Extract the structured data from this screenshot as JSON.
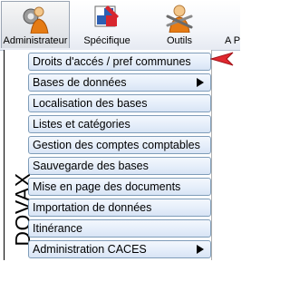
{
  "ribbon": {
    "tabs": [
      {
        "label": "Administrateur",
        "icon": "admin-gear-person-icon"
      },
      {
        "label": "Spécifique",
        "icon": "specific-tools-icon"
      },
      {
        "label": "Outils",
        "icon": "tools-person-icon"
      },
      {
        "label": "A P",
        "icon": ""
      }
    ],
    "active_tab": "Administrateur"
  },
  "panel": {
    "vertical_label": "DOVAX",
    "items": [
      {
        "label": "Droits d'accés / pref communes",
        "has_submenu": false
      },
      {
        "label": "Bases de données",
        "has_submenu": true
      },
      {
        "label": "Localisation des bases",
        "has_submenu": false
      },
      {
        "label": "Listes et catégories",
        "has_submenu": false
      },
      {
        "label": "Gestion des comptes comptables",
        "has_submenu": false
      },
      {
        "label": "Sauvegarde des bases",
        "has_submenu": false
      },
      {
        "label": "Mise en page des documents",
        "has_submenu": false
      },
      {
        "label": "Importation de données",
        "has_submenu": false
      },
      {
        "label": "Itinérance",
        "has_submenu": false
      },
      {
        "label": "Administration CACES",
        "has_submenu": true
      }
    ]
  },
  "colors": {
    "item_border": "#7f9db9",
    "pointer_arrow": "#e0282f"
  }
}
